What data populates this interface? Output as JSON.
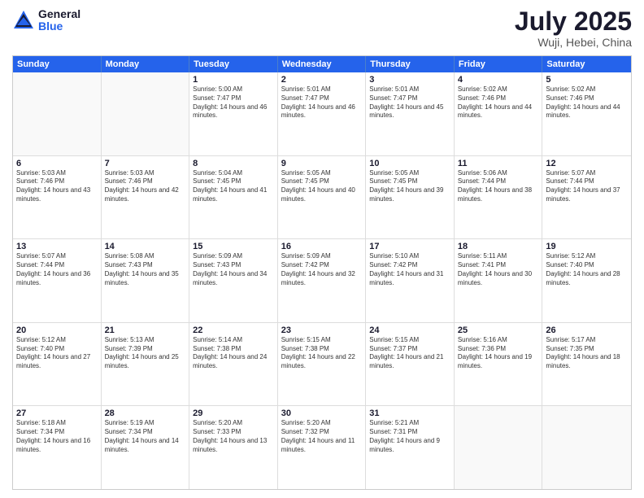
{
  "header": {
    "logo": {
      "general": "General",
      "blue": "Blue"
    },
    "title": "July 2025",
    "location": "Wuji, Hebei, China"
  },
  "calendar": {
    "weekdays": [
      "Sunday",
      "Monday",
      "Tuesday",
      "Wednesday",
      "Thursday",
      "Friday",
      "Saturday"
    ],
    "weeks": [
      [
        {
          "day": "",
          "empty": true
        },
        {
          "day": "",
          "empty": true
        },
        {
          "day": "1",
          "sunrise": "Sunrise: 5:00 AM",
          "sunset": "Sunset: 7:47 PM",
          "daylight": "Daylight: 14 hours and 46 minutes."
        },
        {
          "day": "2",
          "sunrise": "Sunrise: 5:01 AM",
          "sunset": "Sunset: 7:47 PM",
          "daylight": "Daylight: 14 hours and 46 minutes."
        },
        {
          "day": "3",
          "sunrise": "Sunrise: 5:01 AM",
          "sunset": "Sunset: 7:47 PM",
          "daylight": "Daylight: 14 hours and 45 minutes."
        },
        {
          "day": "4",
          "sunrise": "Sunrise: 5:02 AM",
          "sunset": "Sunset: 7:46 PM",
          "daylight": "Daylight: 14 hours and 44 minutes."
        },
        {
          "day": "5",
          "sunrise": "Sunrise: 5:02 AM",
          "sunset": "Sunset: 7:46 PM",
          "daylight": "Daylight: 14 hours and 44 minutes."
        }
      ],
      [
        {
          "day": "6",
          "sunrise": "Sunrise: 5:03 AM",
          "sunset": "Sunset: 7:46 PM",
          "daylight": "Daylight: 14 hours and 43 minutes."
        },
        {
          "day": "7",
          "sunrise": "Sunrise: 5:03 AM",
          "sunset": "Sunset: 7:46 PM",
          "daylight": "Daylight: 14 hours and 42 minutes."
        },
        {
          "day": "8",
          "sunrise": "Sunrise: 5:04 AM",
          "sunset": "Sunset: 7:45 PM",
          "daylight": "Daylight: 14 hours and 41 minutes."
        },
        {
          "day": "9",
          "sunrise": "Sunrise: 5:05 AM",
          "sunset": "Sunset: 7:45 PM",
          "daylight": "Daylight: 14 hours and 40 minutes."
        },
        {
          "day": "10",
          "sunrise": "Sunrise: 5:05 AM",
          "sunset": "Sunset: 7:45 PM",
          "daylight": "Daylight: 14 hours and 39 minutes."
        },
        {
          "day": "11",
          "sunrise": "Sunrise: 5:06 AM",
          "sunset": "Sunset: 7:44 PM",
          "daylight": "Daylight: 14 hours and 38 minutes."
        },
        {
          "day": "12",
          "sunrise": "Sunrise: 5:07 AM",
          "sunset": "Sunset: 7:44 PM",
          "daylight": "Daylight: 14 hours and 37 minutes."
        }
      ],
      [
        {
          "day": "13",
          "sunrise": "Sunrise: 5:07 AM",
          "sunset": "Sunset: 7:44 PM",
          "daylight": "Daylight: 14 hours and 36 minutes."
        },
        {
          "day": "14",
          "sunrise": "Sunrise: 5:08 AM",
          "sunset": "Sunset: 7:43 PM",
          "daylight": "Daylight: 14 hours and 35 minutes."
        },
        {
          "day": "15",
          "sunrise": "Sunrise: 5:09 AM",
          "sunset": "Sunset: 7:43 PM",
          "daylight": "Daylight: 14 hours and 34 minutes."
        },
        {
          "day": "16",
          "sunrise": "Sunrise: 5:09 AM",
          "sunset": "Sunset: 7:42 PM",
          "daylight": "Daylight: 14 hours and 32 minutes."
        },
        {
          "day": "17",
          "sunrise": "Sunrise: 5:10 AM",
          "sunset": "Sunset: 7:42 PM",
          "daylight": "Daylight: 14 hours and 31 minutes."
        },
        {
          "day": "18",
          "sunrise": "Sunrise: 5:11 AM",
          "sunset": "Sunset: 7:41 PM",
          "daylight": "Daylight: 14 hours and 30 minutes."
        },
        {
          "day": "19",
          "sunrise": "Sunrise: 5:12 AM",
          "sunset": "Sunset: 7:40 PM",
          "daylight": "Daylight: 14 hours and 28 minutes."
        }
      ],
      [
        {
          "day": "20",
          "sunrise": "Sunrise: 5:12 AM",
          "sunset": "Sunset: 7:40 PM",
          "daylight": "Daylight: 14 hours and 27 minutes."
        },
        {
          "day": "21",
          "sunrise": "Sunrise: 5:13 AM",
          "sunset": "Sunset: 7:39 PM",
          "daylight": "Daylight: 14 hours and 25 minutes."
        },
        {
          "day": "22",
          "sunrise": "Sunrise: 5:14 AM",
          "sunset": "Sunset: 7:38 PM",
          "daylight": "Daylight: 14 hours and 24 minutes."
        },
        {
          "day": "23",
          "sunrise": "Sunrise: 5:15 AM",
          "sunset": "Sunset: 7:38 PM",
          "daylight": "Daylight: 14 hours and 22 minutes."
        },
        {
          "day": "24",
          "sunrise": "Sunrise: 5:15 AM",
          "sunset": "Sunset: 7:37 PM",
          "daylight": "Daylight: 14 hours and 21 minutes."
        },
        {
          "day": "25",
          "sunrise": "Sunrise: 5:16 AM",
          "sunset": "Sunset: 7:36 PM",
          "daylight": "Daylight: 14 hours and 19 minutes."
        },
        {
          "day": "26",
          "sunrise": "Sunrise: 5:17 AM",
          "sunset": "Sunset: 7:35 PM",
          "daylight": "Daylight: 14 hours and 18 minutes."
        }
      ],
      [
        {
          "day": "27",
          "sunrise": "Sunrise: 5:18 AM",
          "sunset": "Sunset: 7:34 PM",
          "daylight": "Daylight: 14 hours and 16 minutes."
        },
        {
          "day": "28",
          "sunrise": "Sunrise: 5:19 AM",
          "sunset": "Sunset: 7:34 PM",
          "daylight": "Daylight: 14 hours and 14 minutes."
        },
        {
          "day": "29",
          "sunrise": "Sunrise: 5:20 AM",
          "sunset": "Sunset: 7:33 PM",
          "daylight": "Daylight: 14 hours and 13 minutes."
        },
        {
          "day": "30",
          "sunrise": "Sunrise: 5:20 AM",
          "sunset": "Sunset: 7:32 PM",
          "daylight": "Daylight: 14 hours and 11 minutes."
        },
        {
          "day": "31",
          "sunrise": "Sunrise: 5:21 AM",
          "sunset": "Sunset: 7:31 PM",
          "daylight": "Daylight: 14 hours and 9 minutes."
        },
        {
          "day": "",
          "empty": true
        },
        {
          "day": "",
          "empty": true
        }
      ]
    ]
  }
}
